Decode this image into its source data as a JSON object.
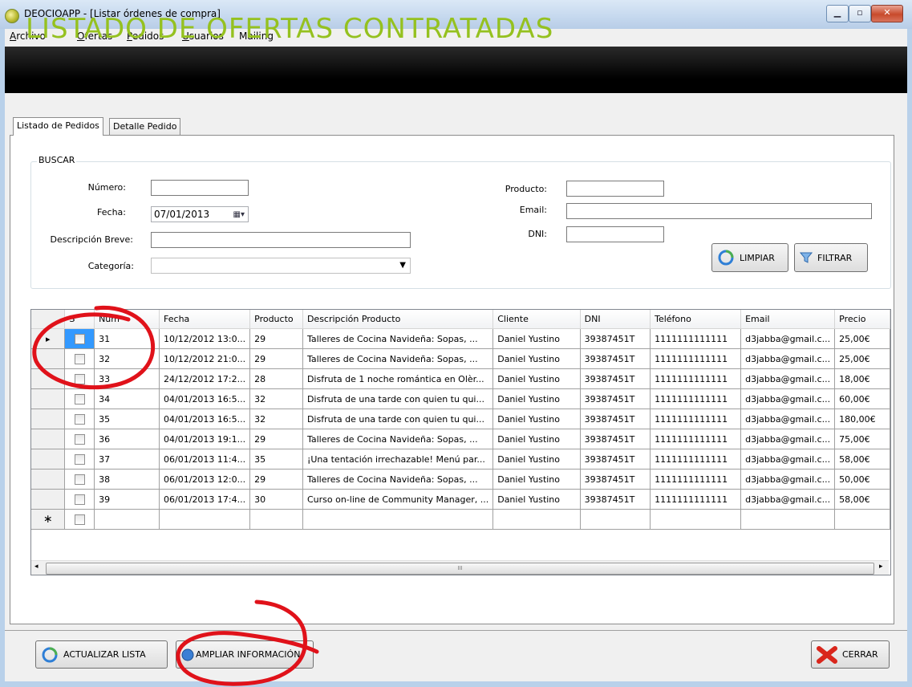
{
  "window": {
    "title": "DEOCIOAPP - [Listar órdenes de compra]"
  },
  "menu": [
    {
      "mnemonic": "A",
      "rest": "rchivo"
    },
    {
      "mnemonic": "O",
      "rest": "fertas"
    },
    {
      "mnemonic": "P",
      "rest": "edidos"
    },
    {
      "mnemonic": "U",
      "rest": "suarios"
    },
    {
      "mnemonic": "",
      "rest": "Mailing"
    }
  ],
  "banner_title": "LISTADO DE OFERTAS CONTRATADAS",
  "tabs": [
    "Listado de Pedidos",
    "Detalle Pedido"
  ],
  "search": {
    "legend": "BUSCAR",
    "numero_label": "Número:",
    "numero_value": "",
    "fecha_label": "Fecha:",
    "fecha_value": "07/01/2013",
    "descripcion_label": "Descripción Breve:",
    "descripcion_value": "",
    "categoria_label": "Categoría:",
    "categoria_value": "",
    "producto_label": "Producto:",
    "producto_value": "",
    "email_label": "Email:",
    "email_value": "",
    "dni_label": "DNI:",
    "dni_value": "",
    "limpiar_label": "LIMPIAR",
    "filtrar_label": "FILTRAR"
  },
  "grid": {
    "columns": [
      "S",
      "Núm",
      "Fecha",
      "Producto",
      "Descripción Producto",
      "Cliente",
      "DNI",
      "Teléfono",
      "Email",
      "Precio"
    ],
    "rows": [
      [
        "31",
        "10/12/2012 13:0...",
        "29",
        "Talleres de Cocina Navideña: Sopas, ...",
        "Daniel Yustino",
        "39387451T",
        "1111111111111",
        "d3jabba@gmail.c...",
        "25,00€"
      ],
      [
        "32",
        "10/12/2012 21:0...",
        "29",
        "Talleres de Cocina Navideña: Sopas, ...",
        "Daniel Yustino",
        "39387451T",
        "1111111111111",
        "d3jabba@gmail.c...",
        "25,00€"
      ],
      [
        "33",
        "24/12/2012 17:2...",
        "28",
        " Disfruta de 1 noche romántica en Olèr...",
        "Daniel Yustino",
        "39387451T",
        "1111111111111",
        "d3jabba@gmail.c...",
        "18,00€"
      ],
      [
        "34",
        "04/01/2013 16:5...",
        "32",
        "Disfruta de una tarde con quien tu qui...",
        "Daniel Yustino",
        "39387451T",
        "1111111111111",
        "d3jabba@gmail.c...",
        "60,00€"
      ],
      [
        "35",
        "04/01/2013 16:5...",
        "32",
        "Disfruta de una tarde con quien tu qui...",
        "Daniel Yustino",
        "39387451T",
        "1111111111111",
        "d3jabba@gmail.c...",
        "180,00€"
      ],
      [
        "36",
        "04/01/2013 19:1...",
        "29",
        "Talleres de Cocina Navideña: Sopas, ...",
        "Daniel Yustino",
        "39387451T",
        "1111111111111",
        "d3jabba@gmail.c...",
        "75,00€"
      ],
      [
        "37",
        "06/01/2013 11:4...",
        "35",
        "¡Una tentación irrechazable! Menú par...",
        "Daniel Yustino",
        "39387451T",
        "1111111111111",
        "d3jabba@gmail.c...",
        "58,00€"
      ],
      [
        "38",
        "06/01/2013 12:0...",
        "29",
        "Talleres de Cocina Navideña: Sopas, ...",
        "Daniel Yustino",
        "39387451T",
        "1111111111111",
        "d3jabba@gmail.c...",
        "50,00€"
      ],
      [
        "39",
        "06/01/2013 17:4...",
        "30",
        "Curso on-line de Community Manager, ...",
        "Daniel Yustino",
        "39387451T",
        "1111111111111",
        "d3jabba@gmail.c...",
        "58,00€"
      ]
    ],
    "current_row_marker": "▸",
    "new_row_marker": "∗",
    "scroll_thumb_grip": "III"
  },
  "buttons": {
    "actualizar": "ACTUALIZAR LISTA",
    "ampliar": "AMPLIAR INFORMACIÓN",
    "cerrar": "CERRAR"
  },
  "colors": {
    "banner_text": "#95c11f",
    "annotation": "#e0121a",
    "selected_cell": "#3399ff"
  }
}
